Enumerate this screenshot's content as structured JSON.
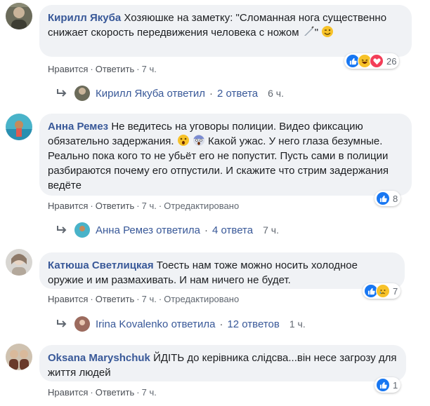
{
  "colors": {
    "author": "#385898",
    "bubble": "#f0f2f5",
    "like": "#1877f2"
  },
  "labels": {
    "like": "Нравится",
    "reply": "Ответить",
    "edited": "Отредактировано",
    "sep": "·"
  },
  "comments": [
    {
      "author": "Кирилл Якуба",
      "text": "Хозяюшке на заметку: \"Сломанная нога существенно снижает скорость передвижения человека с ножом",
      "text_tail": "\"",
      "time": "7 ч.",
      "reactions": [
        "like-icon",
        "haha-icon",
        "love-icon"
      ],
      "reaction_count": "26",
      "replies": {
        "author": "Кирилл Якуба ответил",
        "count": "2 ответа",
        "time": "6 ч."
      }
    },
    {
      "author": "Анна Ремез",
      "text": "Не ведитесь на уговоры полиции. Видео фиксацию обязательно задержания.",
      "text_mid": "Какой ужас. У него глаза безумные. Реально пока кого то не убьёт его не попустит. Пусть сами в полиции разбираются почему его отпустили. И скажите что стрим задержания ведёте",
      "time": "7 ч.",
      "edited": true,
      "reactions": [
        "like-icon"
      ],
      "reaction_count": "8",
      "replies": {
        "author": "Анна Ремез ответила",
        "count": "4 ответа",
        "time": "7 ч."
      }
    },
    {
      "author": "Катюша Светлицкая",
      "text": "Тоесть нам тоже можно носить холодное оружие и им размахивать. И нам ничего не будет.",
      "time": "7 ч.",
      "edited": true,
      "reactions": [
        "like-icon",
        "sad-icon"
      ],
      "reaction_count": "7",
      "replies": {
        "author": "Irina Kovalenko ответила",
        "count": "12 ответов",
        "time": "1 ч."
      }
    },
    {
      "author": "Oksana Maryshchuk",
      "text": "ЙДІТЬ до керівника слідсва...він несе загрозу для життя людей",
      "time": "7 ч.",
      "reactions": [
        "like-icon"
      ],
      "reaction_count": "1"
    }
  ]
}
